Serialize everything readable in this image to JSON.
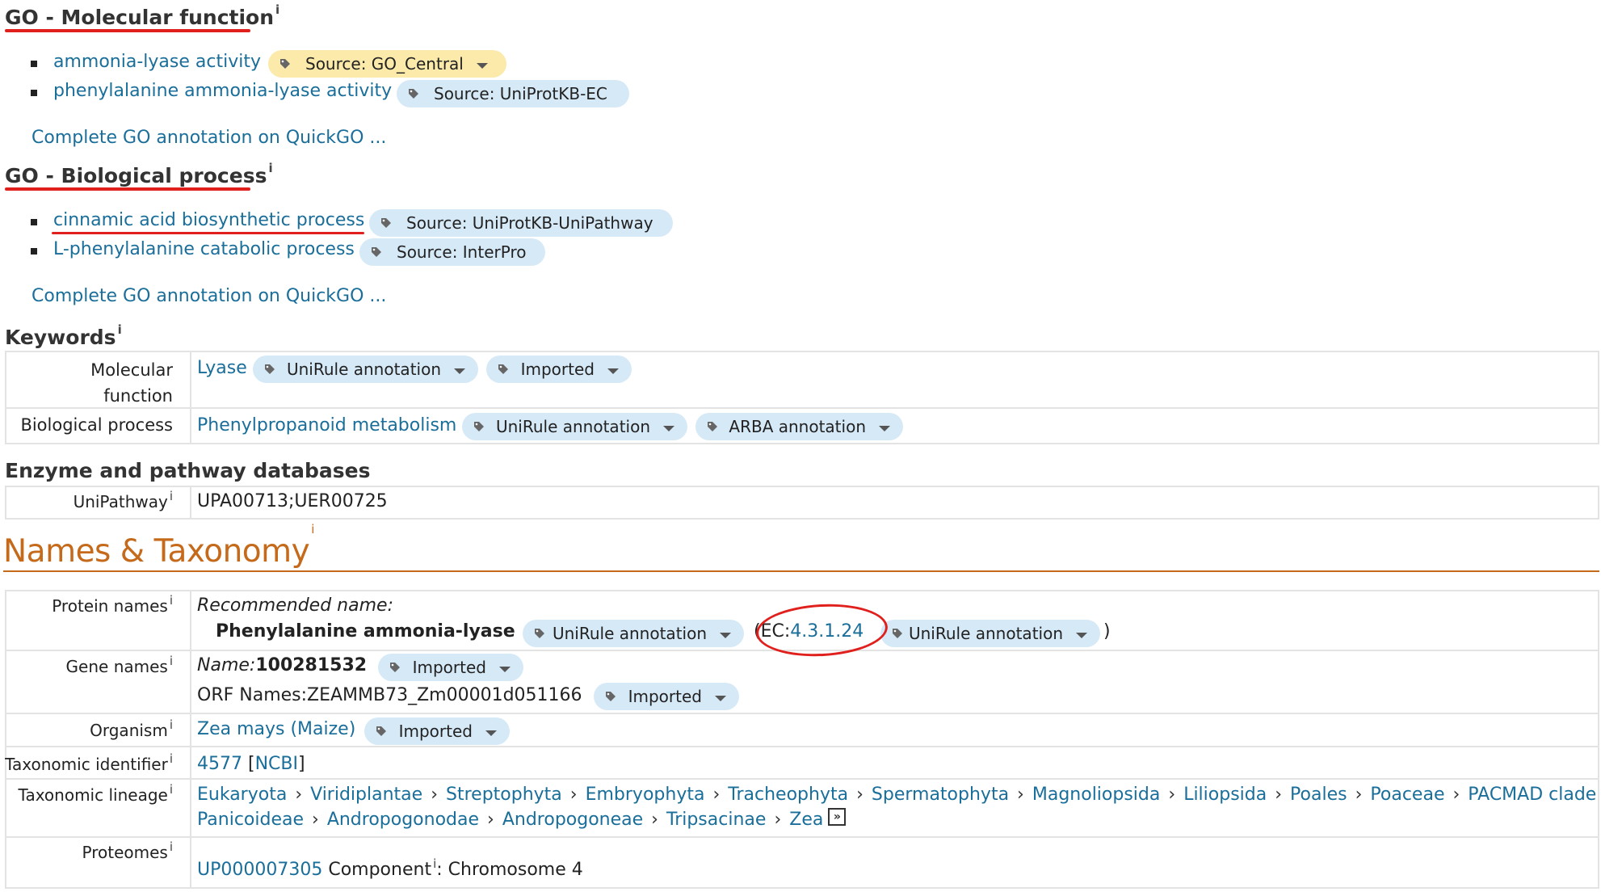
{
  "go_molecular": {
    "title": "GO - Molecular function",
    "info": "i",
    "items": [
      {
        "label": "ammonia-lyase activity",
        "source": "Source: GO_Central"
      },
      {
        "label": "phenylalanine ammonia-lyase activity",
        "source": "Source: UniProtKB-EC"
      }
    ],
    "quickgo": "Complete GO annotation on QuickGO ..."
  },
  "go_biological": {
    "title": "GO - Biological process",
    "info": "i",
    "items": [
      {
        "label": "cinnamic acid biosynthetic process",
        "source": "Source: UniProtKB-UniPathway"
      },
      {
        "label": "L-phenylalanine catabolic process",
        "source": "Source: InterPro"
      }
    ],
    "quickgo": "Complete GO annotation on QuickGO ..."
  },
  "keywords": {
    "title": "Keywords",
    "info": "i",
    "rows": [
      {
        "label_line1": "Molecular",
        "label_line2": "function",
        "value": "Lyase",
        "tags": [
          "UniRule annotation",
          "Imported"
        ]
      },
      {
        "label": "Biological process",
        "value": "Phenylpropanoid metabolism",
        "tags": [
          "UniRule annotation",
          "ARBA annotation"
        ]
      }
    ]
  },
  "enzyme": {
    "title": "Enzyme and pathway databases",
    "row": {
      "label": "UniPathway",
      "info": "i",
      "value": "UPA00713;UER00725"
    }
  },
  "names_taxonomy": {
    "title": "Names & Taxonomy",
    "info": "i",
    "protein_names": {
      "label": "Protein names",
      "recommended_label": "Recommended name:",
      "name": "Phenylalanine ammonia-lyase",
      "tag1": "UniRule annotation",
      "ec_prefix": "(EC:",
      "ec_value": "4.3.1.24",
      "tag2": "UniRule annotation",
      "close_paren": ")"
    },
    "gene_names": {
      "label": "Gene names",
      "name_label": "Name:",
      "name_value": "100281532",
      "tag1": "Imported",
      "orf_text": "ORF Names:ZEAMMB73_Zm00001d051166",
      "tag2": "Imported"
    },
    "organism": {
      "label": "Organism",
      "value": "Zea mays (Maize)",
      "tag": "Imported"
    },
    "taxonomic_identifier": {
      "label": "Taxonomic identifier",
      "id": "4577",
      "ncbi_open": "[",
      "ncbi": "NCBI",
      "ncbi_close": "]"
    },
    "taxonomic_lineage": {
      "label": "Taxonomic lineage",
      "line1": [
        "Eukaryota",
        "Viridiplantae",
        "Streptophyta",
        "Embryophyta",
        "Tracheophyta",
        "Spermatophyta",
        "Magnoliopsida",
        "Liliopsida",
        "Poales",
        "Poaceae",
        "PACMAD clade"
      ],
      "line2": [
        "Panicoideae",
        "Andropogonodae",
        "Andropogoneae",
        "Tripsacinae",
        "Zea"
      ],
      "separator": "›",
      "expand_glyph": "»"
    },
    "proteomes": {
      "label": "Proteomes",
      "id": "UP000007305",
      "component_label": "Component",
      "component_value": ": Chromosome 4"
    }
  },
  "colors": {
    "link": "#1a6e9a",
    "pill_blue": "#d6e9f7",
    "pill_yellow": "#fbeaaa",
    "annotation_red": "#e0201d",
    "section_orange": "#c56a1b"
  }
}
